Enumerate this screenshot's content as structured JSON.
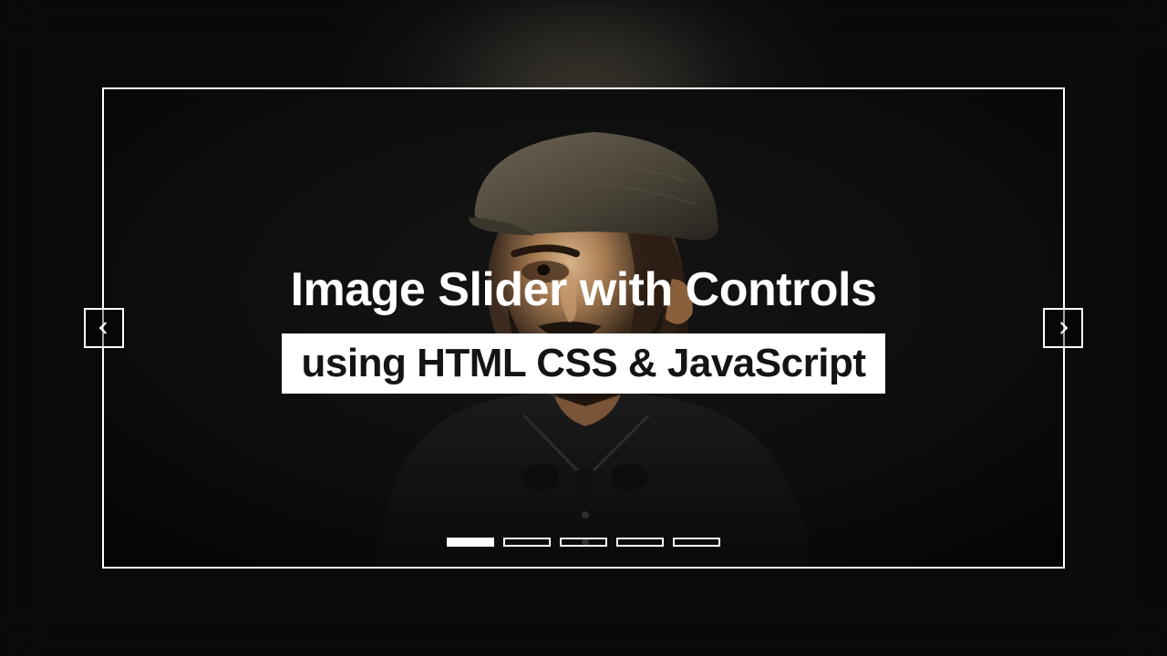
{
  "slider": {
    "title": "Image Slider with Controls",
    "subtitle": "using HTML CSS & JavaScript",
    "total_slides": 5,
    "active_slide_index": 0
  },
  "controls": {
    "prev_label": "Previous",
    "next_label": "Next"
  }
}
